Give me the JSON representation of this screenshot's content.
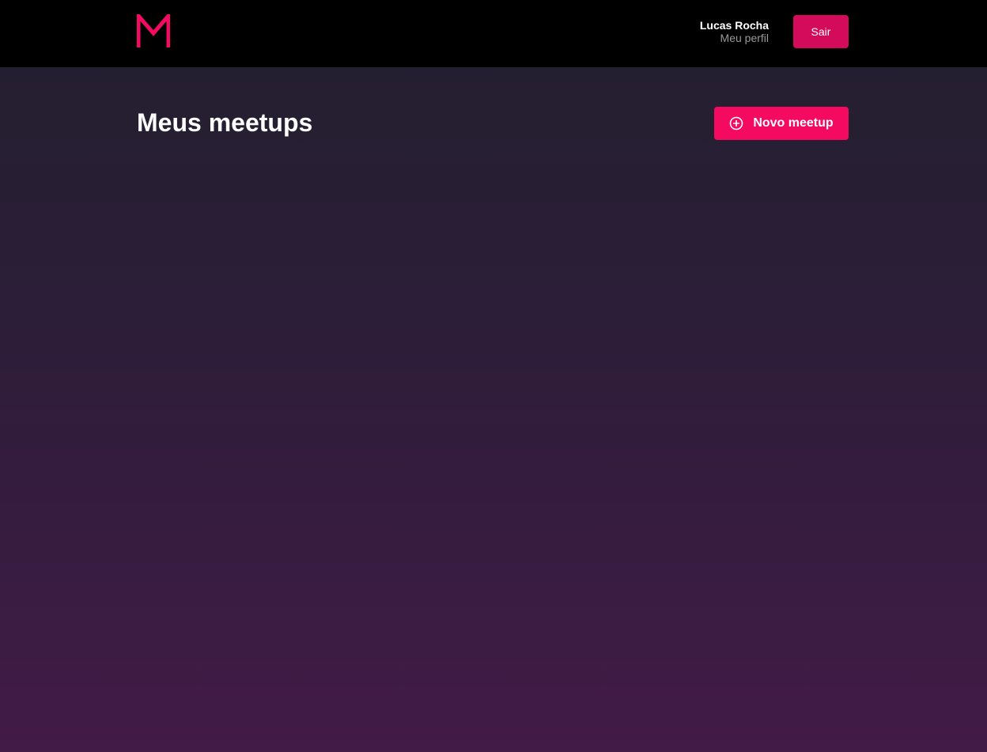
{
  "header": {
    "logo_icon": "m-logo-icon",
    "profile": {
      "name": "Lucas Rocha",
      "link_label": "Meu perfil"
    },
    "logout_label": "Sair"
  },
  "main": {
    "title": "Meus meetups",
    "new_meetup": {
      "icon": "plus-circle-icon",
      "label": "Novo meetup"
    }
  },
  "colors": {
    "brand": "#f50a62",
    "logout_button": "#d40a5a",
    "header_bg": "#000000",
    "background_top": "#22202e",
    "background_bottom": "#421b47"
  }
}
